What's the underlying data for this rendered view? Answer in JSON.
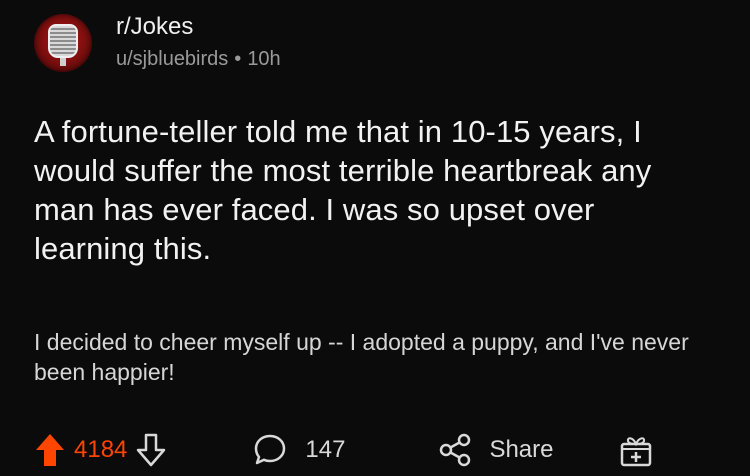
{
  "header": {
    "subreddit": "r/Jokes",
    "username": "u/sjbluebirds",
    "separator": "•",
    "time": "10h"
  },
  "post": {
    "title": "A fortune-teller told me that in 10-15 years, I would suffer the most terrible heartbreak any man has ever faced. I was so upset over learning this.",
    "body": "I decided to cheer myself up -- I adopted a puppy, and I've never been happier!"
  },
  "actions": {
    "upvote_count": "4184",
    "comment_count": "147",
    "share_label": "Share"
  },
  "colors": {
    "upvote": "#ff4500",
    "background": "#0b0b0b",
    "text": "#f2f2f2",
    "muted": "#9a9a9a"
  },
  "icons": {
    "avatar": "microphone-avatar",
    "upvote": "upvote-arrow-icon",
    "downvote": "downvote-arrow-icon",
    "comment": "comment-bubble-icon",
    "share": "share-icon",
    "award": "gift-icon"
  }
}
